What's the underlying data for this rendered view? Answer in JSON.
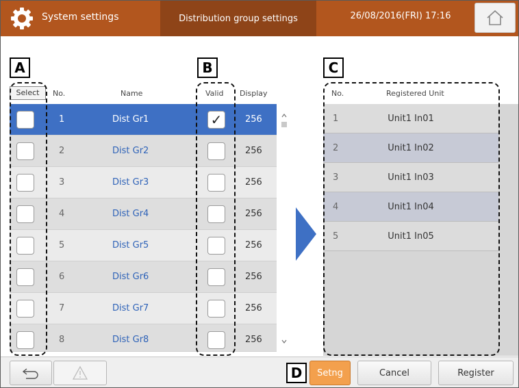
{
  "header": {
    "system_title": "System settings",
    "active_tab": "Distribution group settings",
    "datetime": "26/08/2016(FRI) 17:16",
    "home_icon": "home-icon",
    "settings_icon": "gear-icon"
  },
  "markers": {
    "a": "A",
    "b": "B",
    "c": "C",
    "d": "D"
  },
  "left_table": {
    "headers": {
      "select": "Select",
      "no": "No.",
      "name": "Name",
      "valid": "Valid",
      "display": "Display"
    },
    "rows": [
      {
        "no": "1",
        "name": "Dist Gr1",
        "valid": "✓",
        "display": "256",
        "selected": true
      },
      {
        "no": "2",
        "name": "Dist Gr2",
        "valid": "",
        "display": "256",
        "selected": false
      },
      {
        "no": "3",
        "name": "Dist Gr3",
        "valid": "",
        "display": "256",
        "selected": false
      },
      {
        "no": "4",
        "name": "Dist Gr4",
        "valid": "",
        "display": "256",
        "selected": false
      },
      {
        "no": "5",
        "name": "Dist Gr5",
        "valid": "",
        "display": "256",
        "selected": false
      },
      {
        "no": "6",
        "name": "Dist Gr6",
        "valid": "",
        "display": "256",
        "selected": false
      },
      {
        "no": "7",
        "name": "Dist Gr7",
        "valid": "",
        "display": "256",
        "selected": false
      },
      {
        "no": "8",
        "name": "Dist Gr8",
        "valid": "",
        "display": "256",
        "selected": false
      }
    ]
  },
  "right_table": {
    "headers": {
      "no": "No.",
      "unit": "Registered Unit"
    },
    "rows": [
      {
        "no": "1",
        "unit": "Unit1 In01"
      },
      {
        "no": "2",
        "unit": "Unit1 In02"
      },
      {
        "no": "3",
        "unit": "Unit1 In03"
      },
      {
        "no": "4",
        "unit": "Unit1 In04"
      },
      {
        "no": "5",
        "unit": "Unit1 In05"
      }
    ]
  },
  "footer": {
    "back_icon": "back-arrow-icon",
    "warning_icon": "warning-icon",
    "setng_label": "Setng",
    "cancel_label": "Cancel",
    "register_label": "Register"
  },
  "colors": {
    "header_bg": "#b2561e",
    "active_tab_bg": "#8e4418",
    "selected_row": "#3e70c4",
    "name_text": "#2f63b8",
    "setng_button": "#f3a04d"
  }
}
